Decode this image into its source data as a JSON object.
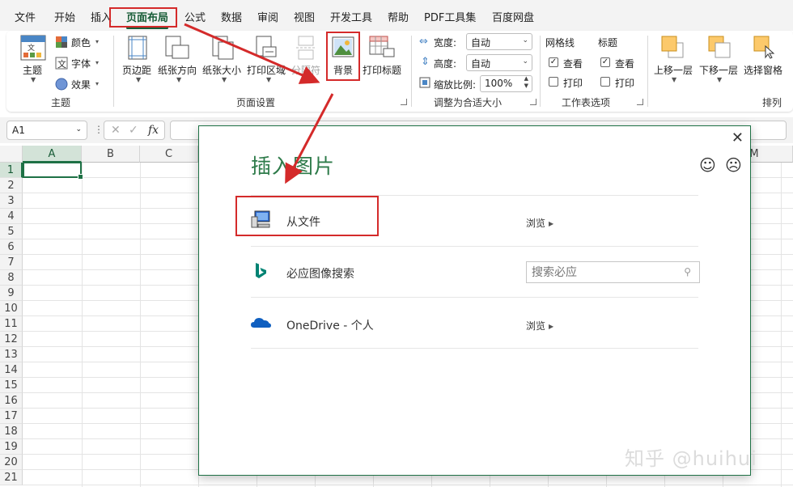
{
  "menu": {
    "tabs": [
      "文件",
      "开始",
      "插入",
      "页面布局",
      "公式",
      "数据",
      "审阅",
      "视图",
      "开发工具",
      "帮助",
      "PDF工具集",
      "百度网盘"
    ],
    "active_tab": "页面布局"
  },
  "ribbon": {
    "theme_group": {
      "theme_button": "主题",
      "colors": "颜色",
      "fonts": "字体",
      "effects": "效果",
      "label": "主题"
    },
    "page_setup_group": {
      "margins": "页边距",
      "orientation": "纸张方向",
      "size": "纸张大小",
      "print_area": "打印区域",
      "breaks": "分隔符",
      "background": "背景",
      "print_titles": "打印标题",
      "label": "页面设置"
    },
    "scale_group": {
      "width_label": "宽度:",
      "width_value": "自动",
      "height_label": "高度:",
      "height_value": "自动",
      "scale_label": "缩放比例:",
      "scale_value": "100%",
      "label": "调整为合适大小"
    },
    "sheet_options_group": {
      "gridlines": "网格线",
      "headings": "标题",
      "view": "查看",
      "print": "打印",
      "label": "工作表选项"
    },
    "arrange_group": {
      "bring_forward": "上移一层",
      "send_backward": "下移一层",
      "selection_pane": "选择窗格",
      "label": "排列"
    }
  },
  "formula_bar": {
    "name_box": "A1",
    "dots": "⋮",
    "cancel": "✕",
    "confirm": "✓",
    "fx": "fx"
  },
  "grid": {
    "columns": [
      "A",
      "B",
      "C"
    ],
    "partial_column": "M",
    "rows": [
      "1",
      "2",
      "3",
      "4",
      "5",
      "6",
      "7",
      "8",
      "9",
      "10",
      "11",
      "12",
      "13",
      "14",
      "15",
      "16",
      "17",
      "18",
      "19",
      "20",
      "21"
    ]
  },
  "dialog": {
    "title": "插入图片",
    "close": "✕",
    "smile": "☺",
    "frown": "☹",
    "options": [
      {
        "label": "从文件",
        "action": "浏览"
      },
      {
        "label": "必应图像搜索",
        "search_placeholder": "搜索必应"
      },
      {
        "label": "OneDrive - 个人",
        "action": "浏览"
      }
    ]
  },
  "watermark": "知乎 @huihui",
  "colors": {
    "accent_green": "#1e7145",
    "title_green": "#2e7b4a",
    "annotation_red": "#d42a2a",
    "bing_teal": "#008373",
    "onedrive_blue": "#0f5fc0"
  }
}
